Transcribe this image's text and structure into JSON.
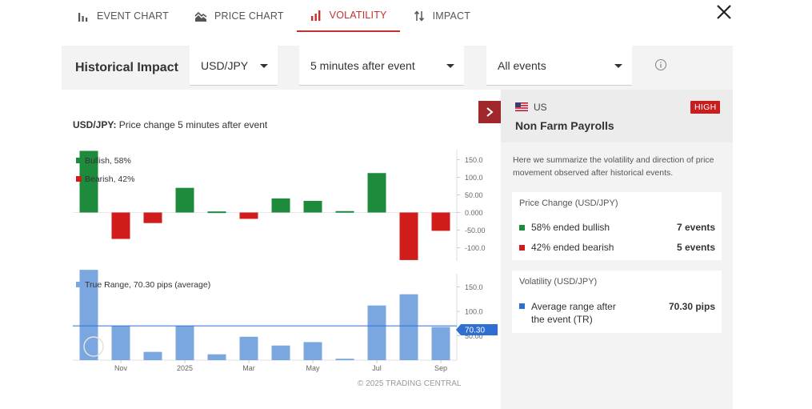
{
  "tabs": [
    {
      "label": "EVENT CHART",
      "icon": "bar-chart-icon",
      "active": false
    },
    {
      "label": "PRICE CHART",
      "icon": "mountain-chart-icon",
      "active": false
    },
    {
      "label": "VOLATILITY",
      "icon": "volatility-bars-icon",
      "active": true
    },
    {
      "label": "IMPACT",
      "icon": "up-down-arrows-icon",
      "active": false
    }
  ],
  "header": {
    "title": "Historical Impact",
    "pair_select": "USD/JPY",
    "timeframe_select": "5 minutes after event",
    "events_select": "All events"
  },
  "chart": {
    "title_bold": "USD/JPY:",
    "title_rest": " Price change 5 minutes after event",
    "legend_bullish": "Bullish, 58%",
    "legend_bearish": "Bearish, 42%",
    "legend_range": "True Range, 70.30 pips (average)",
    "copyright": "© 2025 TRADING CENTRAL",
    "avg_label": "70.30"
  },
  "chart_data": [
    {
      "type": "bar",
      "title": "USD/JPY: Price change 5 minutes after event",
      "series": [
        {
          "name": "Price change",
          "values": [
            175,
            -75,
            -30,
            70,
            3,
            -18,
            40,
            33,
            4,
            112,
            -135,
            -52
          ]
        }
      ],
      "yticks": [
        "150.0",
        "100.0",
        "50.00",
        "0.000",
        "-50.00",
        "-100.0"
      ],
      "ylim": [
        -140,
        180
      ],
      "colors": {
        "bullish": "#1e8a3c",
        "bearish": "#d11c1c"
      }
    },
    {
      "type": "bar",
      "series": [
        {
          "name": "True Range",
          "values": [
            185,
            70,
            17,
            70,
            12,
            48,
            30,
            37,
            3,
            112,
            135,
            68
          ]
        }
      ],
      "xticks": [
        "Nov",
        "2025",
        "Mar",
        "May",
        "Jul",
        "Sep"
      ],
      "xtick_index": [
        1.5,
        3.5,
        5.5,
        7.5,
        9.5,
        11.5
      ],
      "yticks": [
        "150.0",
        "100.0",
        "50.00"
      ],
      "ylim": [
        0,
        200
      ],
      "average": 70.3,
      "color": "#7ba7e0"
    }
  ],
  "side": {
    "country": "US",
    "impact": "HIGH",
    "event": "Non Farm Payrolls",
    "summary": "Here we summarize the volatility and direction of price movement observed after historical events.",
    "price_title": "Price Change (USD/JPY)",
    "bullish_label": "58% ended bullish",
    "bullish_value": "7 events",
    "bearish_label": "42% ended bearish",
    "bearish_value": "5 events",
    "vol_title": "Volatility (USD/JPY)",
    "range_label_1": "Average range after",
    "range_label_2": "the event (TR)",
    "range_value": "70.30 pips"
  }
}
